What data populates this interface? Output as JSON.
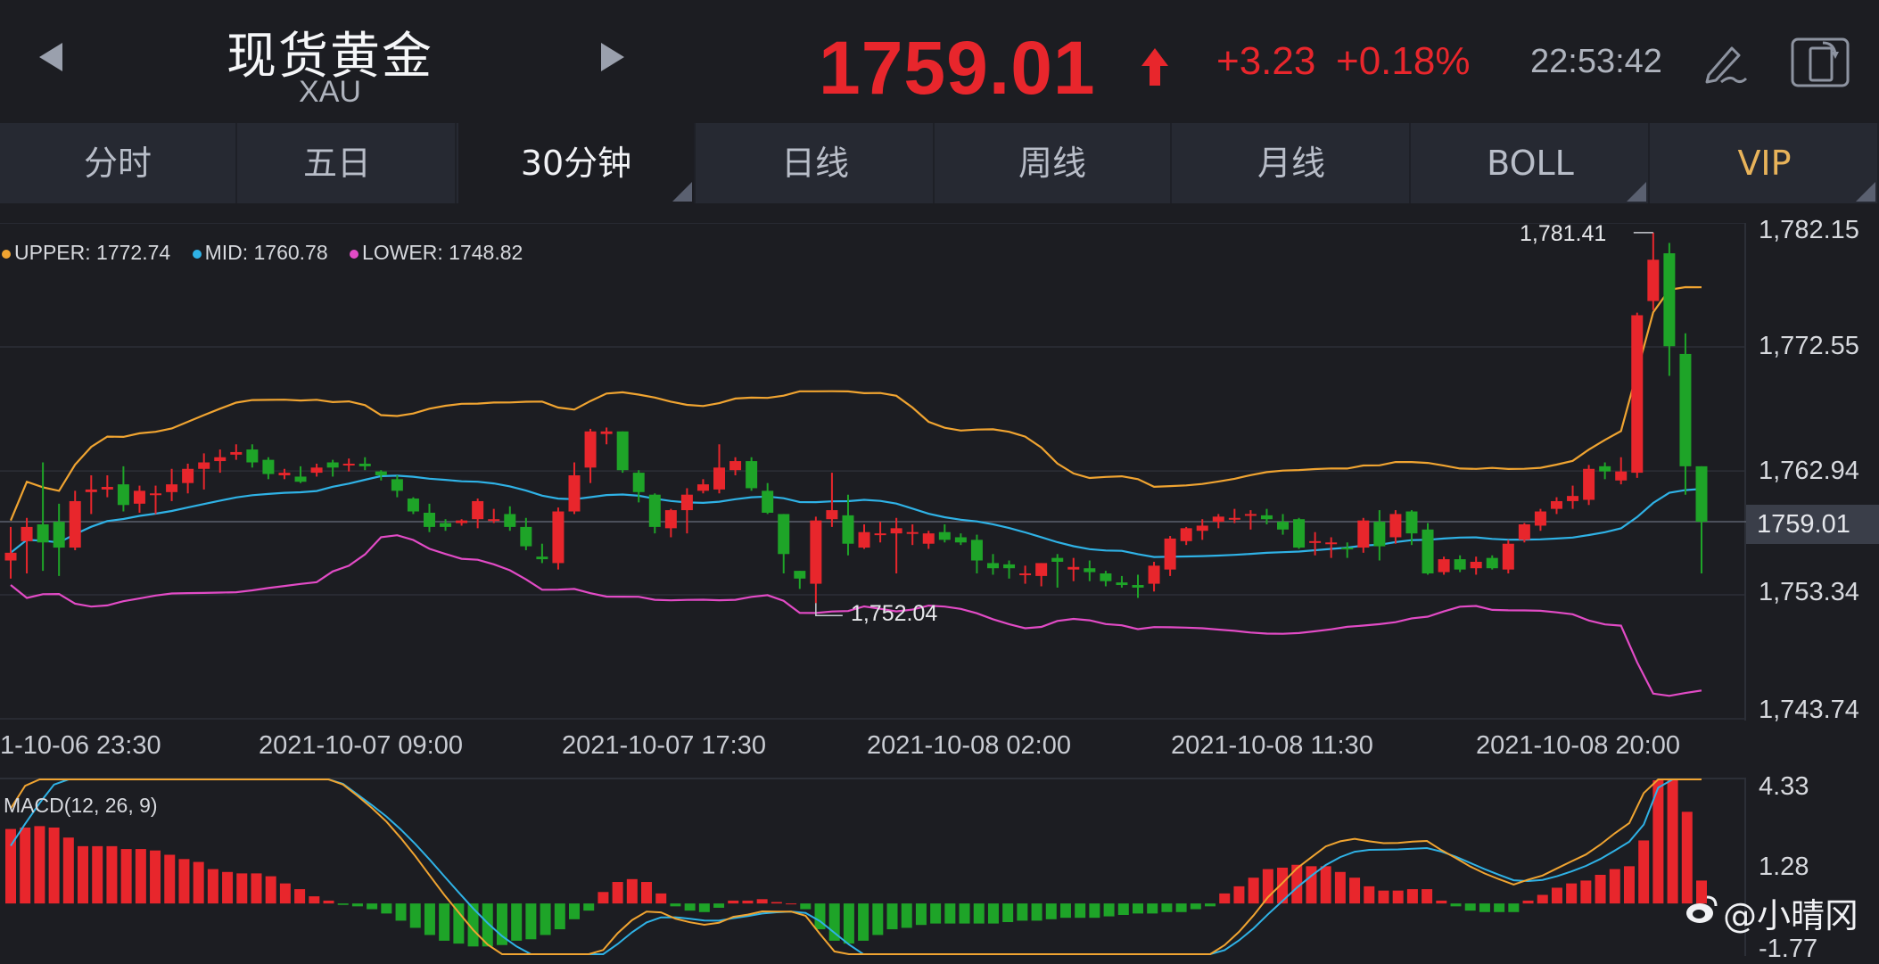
{
  "header": {
    "title": "现货黄金",
    "symbol": "XAU",
    "price": "1759.01",
    "change": "+3.23",
    "change_pct": "+0.18%",
    "time": "22:53:42",
    "price_color": "#e8262c"
  },
  "tabs": [
    {
      "label": "分时",
      "active": false
    },
    {
      "label": "五日",
      "active": false
    },
    {
      "label": "30分钟",
      "active": true
    },
    {
      "label": "日线",
      "active": false
    },
    {
      "label": "周线",
      "active": false
    },
    {
      "label": "月线",
      "active": false
    },
    {
      "label": "BOLL",
      "active": false
    },
    {
      "label": "VIP",
      "active": false
    }
  ],
  "boll_legend": {
    "upper": "UPPER: 1772.74",
    "mid": "MID: 1760.78",
    "lower": "LOWER: 1748.82",
    "upper_color": "#f0a431",
    "mid_color": "#2fb2e6",
    "lower_color": "#e24bc6"
  },
  "macd_label": "MACD(12, 26, 9)",
  "price_axis": [
    "1,782.15",
    "1,772.55",
    "1,762.94",
    "1,753.34",
    "1,743.74"
  ],
  "macd_axis": [
    "4.33",
    "1.28",
    "-1.77"
  ],
  "current_price_tag": "1759.01",
  "time_axis": [
    "1-10-06 23:30",
    "2021-10-07 09:00",
    "2021-10-07 17:30",
    "2021-10-08 02:00",
    "2021-10-08 11:30",
    "2021-10-08 20:00"
  ],
  "annotations": {
    "high": "1,781.41",
    "low": "1,752.04"
  },
  "watermark": "@小晴冈",
  "icons": [
    "left-arrow-icon",
    "right-arrow-icon",
    "up-arrow-icon",
    "pen-icon",
    "rotate-screen-icon",
    "weibo-icon"
  ],
  "chart_data": [
    {
      "type": "candlestick",
      "title": "",
      "ylim": [
        1743.74,
        1782.15
      ],
      "up_color": "#e8262c",
      "down_color": "#1ea428",
      "candles": [
        [
          1756.0,
          1758.6,
          1754.6,
          1756.6
        ],
        [
          1757.5,
          1759.3,
          1755.0,
          1758.6
        ],
        [
          1758.8,
          1763.6,
          1755.2,
          1757.4
        ],
        [
          1759.0,
          1760.4,
          1754.8,
          1757.0
        ],
        [
          1757.0,
          1761.4,
          1756.8,
          1760.6
        ],
        [
          1761.3,
          1762.6,
          1759.6,
          1761.5
        ],
        [
          1761.5,
          1762.6,
          1760.9,
          1761.7
        ],
        [
          1761.9,
          1763.3,
          1759.8,
          1760.3
        ],
        [
          1760.4,
          1761.8,
          1759.7,
          1761.4
        ],
        [
          1761.2,
          1761.8,
          1759.6,
          1761.2
        ],
        [
          1761.3,
          1763.1,
          1760.6,
          1761.9
        ],
        [
          1762.0,
          1763.5,
          1761.2,
          1763.1
        ],
        [
          1763.1,
          1764.3,
          1761.5,
          1763.6
        ],
        [
          1763.7,
          1764.6,
          1762.8,
          1764.0
        ],
        [
          1764.2,
          1765.0,
          1763.8,
          1764.4
        ],
        [
          1764.6,
          1765.0,
          1763.2,
          1763.6
        ],
        [
          1763.8,
          1764.0,
          1762.3,
          1762.7
        ],
        [
          1762.6,
          1763.1,
          1762.3,
          1762.8
        ],
        [
          1762.5,
          1763.3,
          1762.0,
          1762.1
        ],
        [
          1762.8,
          1763.5,
          1762.5,
          1763.2
        ],
        [
          1763.6,
          1763.8,
          1762.5,
          1763.2
        ],
        [
          1763.4,
          1763.9,
          1762.9,
          1763.5
        ],
        [
          1763.5,
          1764.0,
          1763.0,
          1763.3
        ],
        [
          1762.9,
          1763.0,
          1762.2,
          1762.6
        ],
        [
          1762.3,
          1762.6,
          1760.9,
          1761.4
        ],
        [
          1760.8,
          1760.9,
          1759.6,
          1759.8
        ],
        [
          1759.7,
          1760.4,
          1758.2,
          1758.6
        ],
        [
          1758.9,
          1759.2,
          1758.3,
          1758.6
        ],
        [
          1758.9,
          1759.2,
          1758.7,
          1759.1
        ],
        [
          1759.2,
          1760.8,
          1758.5,
          1760.6
        ],
        [
          1759.2,
          1760.0,
          1758.9,
          1759.2
        ],
        [
          1759.6,
          1760.2,
          1758.3,
          1758.6
        ],
        [
          1758.6,
          1759.3,
          1756.8,
          1757.1
        ],
        [
          1756.3,
          1757.3,
          1755.8,
          1756.1
        ],
        [
          1755.8,
          1760.1,
          1755.3,
          1759.8
        ],
        [
          1759.8,
          1763.6,
          1759.6,
          1762.6
        ],
        [
          1763.2,
          1766.2,
          1762.0,
          1766.0
        ],
        [
          1765.8,
          1766.3,
          1765.0,
          1766.0
        ],
        [
          1766.0,
          1766.0,
          1762.8,
          1763.0
        ],
        [
          1762.8,
          1763.0,
          1760.5,
          1761.3
        ],
        [
          1761.1,
          1761.2,
          1758.1,
          1758.6
        ],
        [
          1758.5,
          1760.0,
          1757.8,
          1759.9
        ],
        [
          1759.9,
          1761.6,
          1758.1,
          1761.1
        ],
        [
          1761.4,
          1762.3,
          1761.2,
          1761.9
        ],
        [
          1761.5,
          1765.0,
          1761.2,
          1763.2
        ],
        [
          1763.0,
          1764.0,
          1762.6,
          1763.7
        ],
        [
          1763.7,
          1764.0,
          1761.4,
          1761.6
        ],
        [
          1761.4,
          1762.0,
          1759.6,
          1759.7
        ],
        [
          1759.6,
          1759.6,
          1755.0,
          1756.5
        ],
        [
          1755.2,
          1755.2,
          1753.8,
          1754.6
        ],
        [
          1754.2,
          1759.4,
          1752.7,
          1759.1
        ],
        [
          1759.2,
          1762.8,
          1758.6,
          1759.9
        ],
        [
          1759.5,
          1761.1,
          1756.4,
          1757.3
        ],
        [
          1757.0,
          1758.8,
          1756.9,
          1758.2
        ],
        [
          1758.0,
          1759.0,
          1757.4,
          1758.1
        ],
        [
          1758.1,
          1759.3,
          1755.0,
          1758.5
        ],
        [
          1758.2,
          1758.8,
          1757.2,
          1758.2
        ],
        [
          1757.3,
          1758.3,
          1756.9,
          1758.1
        ],
        [
          1758.2,
          1758.8,
          1757.4,
          1757.6
        ],
        [
          1757.8,
          1758.1,
          1757.2,
          1757.4
        ],
        [
          1757.6,
          1758.0,
          1755.0,
          1756.0
        ],
        [
          1755.8,
          1756.5,
          1754.9,
          1755.4
        ],
        [
          1755.7,
          1756.0,
          1754.6,
          1755.4
        ],
        [
          1755.0,
          1755.6,
          1754.2,
          1755.0
        ],
        [
          1754.8,
          1755.8,
          1754.0,
          1755.8
        ],
        [
          1756.2,
          1756.5,
          1753.9,
          1755.9
        ],
        [
          1755.3,
          1756.2,
          1754.4,
          1755.5
        ],
        [
          1755.4,
          1756.0,
          1754.4,
          1755.1
        ],
        [
          1755.0,
          1755.2,
          1754.0,
          1754.4
        ],
        [
          1754.3,
          1754.8,
          1753.9,
          1754.1
        ],
        [
          1754.1,
          1754.9,
          1753.1,
          1753.9
        ],
        [
          1754.2,
          1755.9,
          1753.6,
          1755.6
        ],
        [
          1755.3,
          1757.9,
          1754.8,
          1757.7
        ],
        [
          1757.5,
          1758.6,
          1757.2,
          1758.5
        ],
        [
          1758.3,
          1759.2,
          1757.6,
          1758.7
        ],
        [
          1759.0,
          1759.6,
          1758.5,
          1759.4
        ],
        [
          1759.2,
          1760.0,
          1758.9,
          1759.3
        ],
        [
          1759.5,
          1759.9,
          1758.4,
          1759.6
        ],
        [
          1759.5,
          1760.0,
          1758.8,
          1759.2
        ],
        [
          1759.0,
          1759.6,
          1758.0,
          1758.4
        ],
        [
          1759.2,
          1759.3,
          1756.9,
          1757.0
        ],
        [
          1757.5,
          1758.2,
          1756.4,
          1757.5
        ],
        [
          1757.3,
          1757.8,
          1756.2,
          1757.4
        ],
        [
          1757.0,
          1757.4,
          1756.2,
          1756.9
        ],
        [
          1757.0,
          1759.3,
          1756.6,
          1759.1
        ],
        [
          1759.0,
          1759.9,
          1756.0,
          1757.1
        ],
        [
          1757.8,
          1759.9,
          1757.3,
          1759.6
        ],
        [
          1759.8,
          1759.9,
          1757.2,
          1758.1
        ],
        [
          1758.4,
          1758.9,
          1754.9,
          1755.0
        ],
        [
          1755.1,
          1756.3,
          1754.9,
          1756.1
        ],
        [
          1756.1,
          1756.4,
          1755.1,
          1755.3
        ],
        [
          1755.4,
          1756.3,
          1754.9,
          1755.9
        ],
        [
          1756.2,
          1756.4,
          1755.3,
          1755.4
        ],
        [
          1755.3,
          1757.6,
          1755.0,
          1757.3
        ],
        [
          1757.6,
          1758.9,
          1757.4,
          1758.8
        ],
        [
          1758.7,
          1760.0,
          1758.3,
          1759.8
        ],
        [
          1760.0,
          1760.9,
          1759.6,
          1760.6
        ],
        [
          1760.6,
          1761.8,
          1760.0,
          1761.0
        ],
        [
          1760.7,
          1763.4,
          1760.3,
          1763.1
        ],
        [
          1763.3,
          1763.6,
          1762.3,
          1762.9
        ],
        [
          1762.2,
          1764.0,
          1761.9,
          1762.9
        ],
        [
          1762.8,
          1775.2,
          1762.4,
          1775.0
        ],
        [
          1776.1,
          1781.4,
          1775.4,
          1779.3
        ],
        [
          1779.8,
          1780.6,
          1770.3,
          1772.6
        ],
        [
          1772.0,
          1773.6,
          1761.1,
          1763.3
        ],
        [
          1763.3,
          1763.3,
          1755.0,
          1759.0
        ]
      ],
      "bollinger": {
        "upper_range": [
          1756.1,
          1773.1
        ],
        "mid_range": [
          1754.7,
          1762.2
        ],
        "lower_range": [
          1744.5,
          1759.1
        ],
        "current": {
          "upper": 1772.74,
          "mid": 1760.78,
          "lower": 1748.82
        }
      },
      "labels": {
        "high": "1,781.41",
        "low": "1,752.04"
      }
    },
    {
      "type": "bar",
      "title": "MACD(12, 26, 9)",
      "ylim": [
        -1.77,
        4.33
      ],
      "histogram": [
        2.6,
        2.65,
        2.7,
        2.65,
        2.3,
        2.0,
        2.0,
        2.0,
        1.9,
        1.9,
        1.85,
        1.7,
        1.55,
        1.45,
        1.2,
        1.1,
        1.05,
        1.05,
        0.95,
        0.7,
        0.5,
        0.25,
        0.1,
        -0.05,
        -0.1,
        -0.2,
        -0.35,
        -0.6,
        -0.85,
        -1.1,
        -1.3,
        -1.4,
        -1.5,
        -1.5,
        -1.45,
        -1.3,
        -1.25,
        -1.1,
        -0.9,
        -0.55,
        -0.25,
        0.4,
        0.75,
        0.85,
        0.75,
        0.35,
        -0.1,
        -0.25,
        -0.3,
        -0.15,
        0.1,
        0.1,
        0.15,
        0.05,
        0.0,
        -0.2,
        -0.9,
        -1.3,
        -1.4,
        -1.3,
        -1.1,
        -0.9,
        -0.85,
        -0.75,
        -0.7,
        -0.7,
        -0.7,
        -0.7,
        -0.7,
        -0.65,
        -0.6,
        -0.6,
        -0.55,
        -0.5,
        -0.5,
        -0.5,
        -0.45,
        -0.4,
        -0.35,
        -0.35,
        -0.3,
        -0.3,
        -0.2,
        -0.1,
        0.35,
        0.6,
        0.9,
        1.2,
        1.25,
        1.35,
        1.3,
        1.3,
        1.1,
        0.9,
        0.6,
        0.45,
        0.45,
        0.5,
        0.5,
        0.1,
        -0.1,
        -0.25,
        -0.3,
        -0.3,
        -0.3,
        0.1,
        0.3,
        0.55,
        0.7,
        0.8,
        1.0,
        1.2,
        1.3,
        2.2,
        4.3,
        4.3,
        3.2,
        0.8
      ],
      "dif_range": [
        -1.7,
        4.2
      ],
      "dea_range": [
        -1.6,
        3.0
      ]
    }
  ]
}
